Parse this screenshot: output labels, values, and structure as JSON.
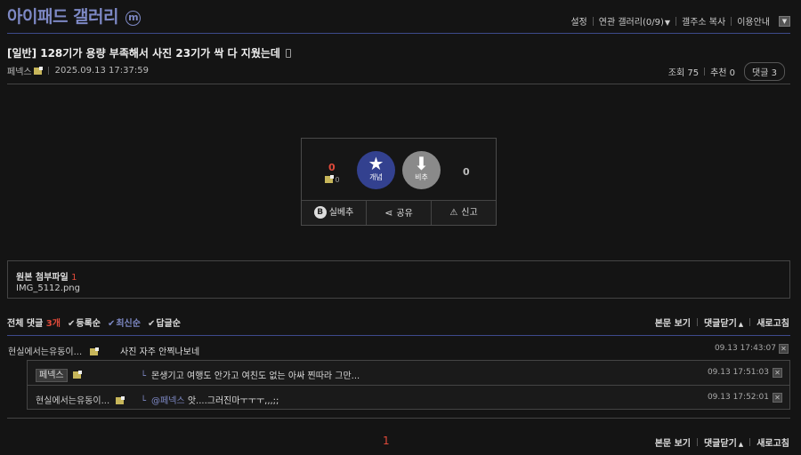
{
  "gallery": {
    "title": "아이패드 갤러리",
    "badge": "m"
  },
  "topnav": {
    "settings": "설정",
    "related": "연관 갤러리(0/9)",
    "copy": "갤주소 복사",
    "guide": "이용안내"
  },
  "post": {
    "title": "[일반] 128기가 용량 부족해서 사진 23기가 싹 다 지웠는데",
    "author": "페넥스",
    "datetime": "2025.09.13 17:37:59",
    "views_label": "조회 75",
    "recommend_label": "추천 0",
    "comments_label": "댓글 3"
  },
  "vote": {
    "up_count": "0",
    "fix_count": "0",
    "up_label": "개념",
    "down_label": "비추",
    "down_count": "0",
    "btn_realtime": "실베추",
    "btn_share": "공유",
    "btn_report": "신고",
    "b_letter": "B"
  },
  "attachment": {
    "label": "원본 첨부파일",
    "count": "1",
    "filename": "IMG_5112.png"
  },
  "comments_bar": {
    "total_label": "전체 댓글",
    "total_count": "3개",
    "sort_reg": "등록순",
    "sort_new": "최신순",
    "sort_reply": "답글순",
    "view_body": "본문 보기",
    "close_comments": "댓글닫기",
    "refresh": "새로고침"
  },
  "comments": [
    {
      "author": "현실에서는유동이...",
      "text": "사진 자주 안찍나보네",
      "time": "09.13 17:43:07"
    }
  ],
  "replies": [
    {
      "author": "페넥스",
      "text": "몬생기고 여행도 안가고 여친도 없는 아싸 찐따라 그만...",
      "time": "09.13 17:51:03"
    },
    {
      "author": "현실에서는유동이...",
      "mention": "@페넥스",
      "text": "앗....그러진마ㅜㅜㅜ,,,;;",
      "time": "09.13 17:52:01"
    }
  ],
  "pagination": {
    "current": "1"
  },
  "colors": {
    "accent": "#7d88c4",
    "red": "#e04a3a",
    "up_circle": "#33418f",
    "down_circle": "#8a8a8a"
  }
}
